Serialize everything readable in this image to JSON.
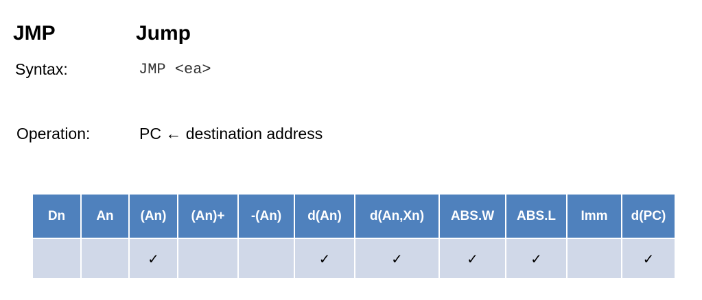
{
  "instruction": {
    "mnemonic": "JMP",
    "name": "Jump",
    "syntax_label": "Syntax:",
    "syntax": "JMP <ea>",
    "operation_label": "Operation:",
    "operation": "PC ← destination address"
  },
  "modes_table": {
    "headers": [
      "Dn",
      "An",
      "(An)",
      "(An)+",
      "-(An)",
      "d(An)",
      "d(An,Xn)",
      "ABS.W",
      "ABS.L",
      "Imm",
      "d(PC)"
    ],
    "cells": [
      "",
      "",
      "✓",
      "",
      "",
      "✓",
      "✓",
      "✓",
      "✓",
      "",
      "✓"
    ]
  }
}
